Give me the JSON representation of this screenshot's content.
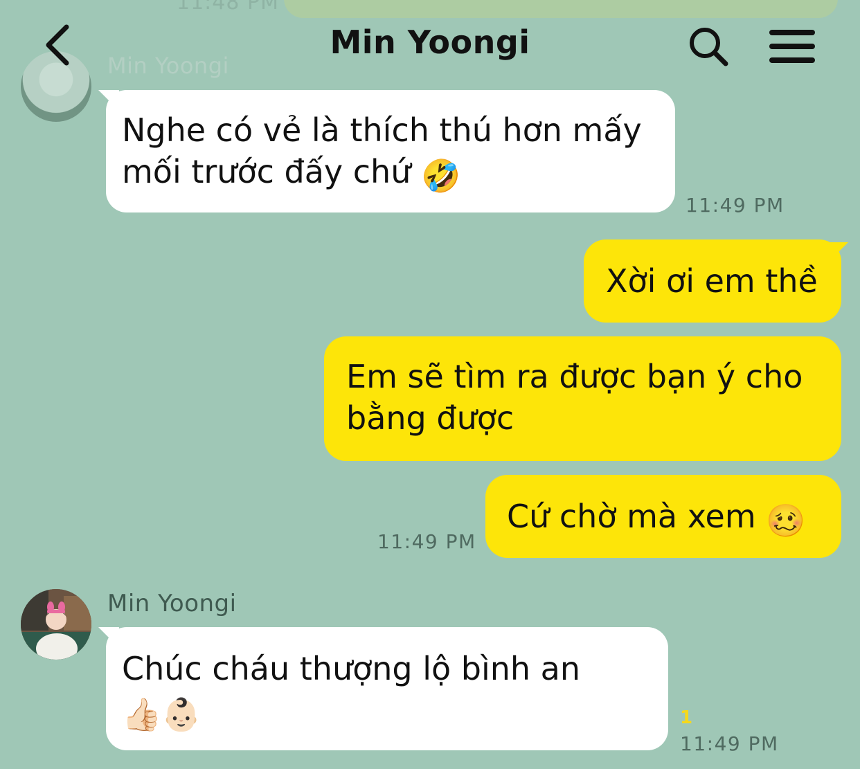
{
  "header": {
    "title": "Min Yoongi"
  },
  "ghost": {
    "time": "11:48 PM",
    "sender_name": "Min Yoongi"
  },
  "messages": [
    {
      "direction": "incoming",
      "text": "Nghe có vẻ là thích thú hơn mấy mối trước đấy chứ",
      "emoji": "🤣",
      "time": "11:49 PM"
    },
    {
      "direction": "outgoing",
      "text": "Xời ơi em thề"
    },
    {
      "direction": "outgoing",
      "text": "Em sẽ tìm ra được bạn ý cho bằng được"
    },
    {
      "direction": "outgoing",
      "text": "Cứ chờ mà xem",
      "emoji": "🥴",
      "time": "11:49 PM"
    },
    {
      "direction": "incoming",
      "sender_name": "Min Yoongi",
      "text": "Chúc cháu thượng lộ bình an",
      "emoji": "👍🏻👶🏻",
      "unread_count": "1",
      "time": "11:49 PM"
    }
  ],
  "colors": {
    "background": "#9fc7b6",
    "incoming_bubble": "#ffffff",
    "outgoing_bubble": "#fde509",
    "unread_badge": "#f6d81a"
  },
  "icons": {
    "back": "chevron-left-icon",
    "search": "search-icon",
    "menu": "hamburger-menu-icon"
  }
}
